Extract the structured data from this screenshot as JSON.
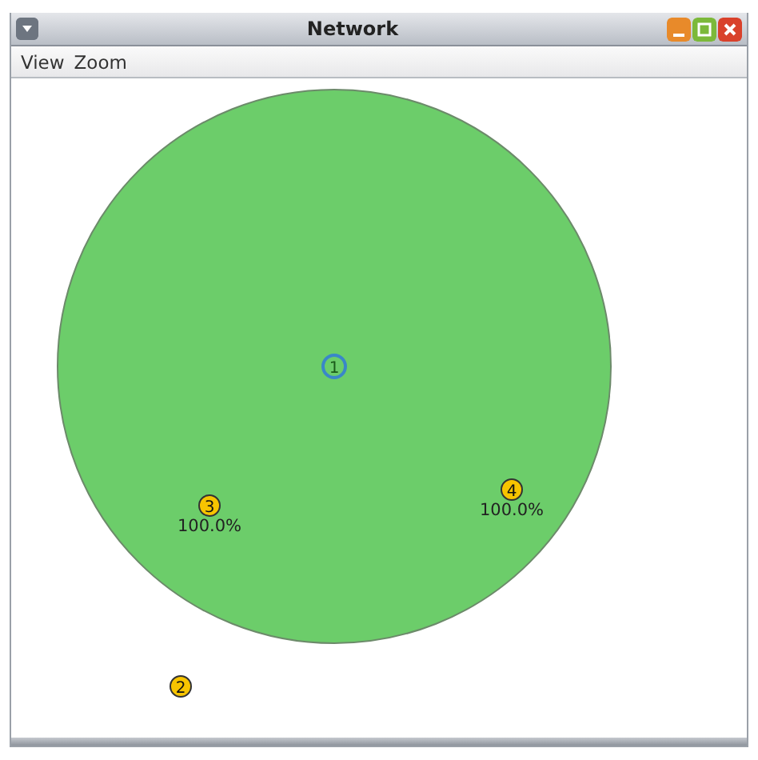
{
  "window": {
    "title": "Network"
  },
  "menu": [
    {
      "label": "View"
    },
    {
      "label": "Zoom"
    }
  ],
  "nodes": [
    {
      "label": "1",
      "kind": "hub"
    },
    {
      "label": "2",
      "kind": "station"
    },
    {
      "label": "3",
      "kind": "station",
      "reading": "100.0%"
    },
    {
      "label": "4",
      "kind": "station",
      "reading": "100.0%"
    }
  ]
}
